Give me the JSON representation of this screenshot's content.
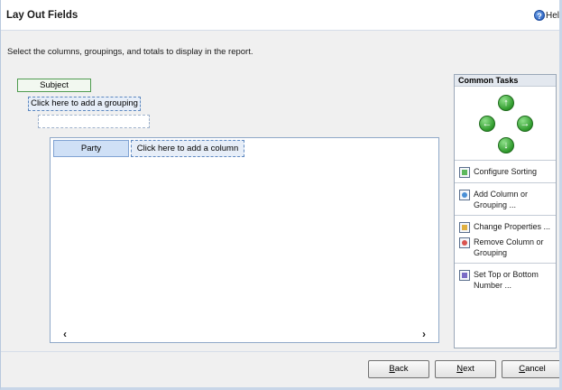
{
  "window": {
    "title": "Lay Out Fields",
    "help_label": "Help"
  },
  "instructions": "Select the columns, groupings, and totals to display in the report.",
  "layout": {
    "grouping_field": "Subject",
    "add_grouping_label": "Click here to add a grouping",
    "columns": [
      "Party"
    ],
    "add_column_label": "Click here to add a column"
  },
  "common_tasks": {
    "title": "Common Tasks",
    "arrows": [
      "up",
      "left",
      "right",
      "down"
    ],
    "sections": [
      {
        "items": [
          {
            "label": "Configure Sorting",
            "icon": "sort-icon"
          }
        ]
      },
      {
        "items": [
          {
            "label": "Add Column or Grouping ...",
            "icon": "add-column-icon"
          }
        ]
      },
      {
        "items": [
          {
            "label": "Change Properties ...",
            "icon": "properties-icon"
          },
          {
            "label": "Remove Column or Grouping",
            "icon": "remove-icon"
          }
        ]
      },
      {
        "items": [
          {
            "label": "Set Top or Bottom Number ...",
            "icon": "top-bottom-icon"
          }
        ]
      }
    ]
  },
  "footer": {
    "back": {
      "mnemonic": "B",
      "rest": "ack"
    },
    "next": {
      "mnemonic": "N",
      "rest": "ext"
    },
    "cancel": {
      "mnemonic": "C",
      "rest": "ancel"
    }
  }
}
